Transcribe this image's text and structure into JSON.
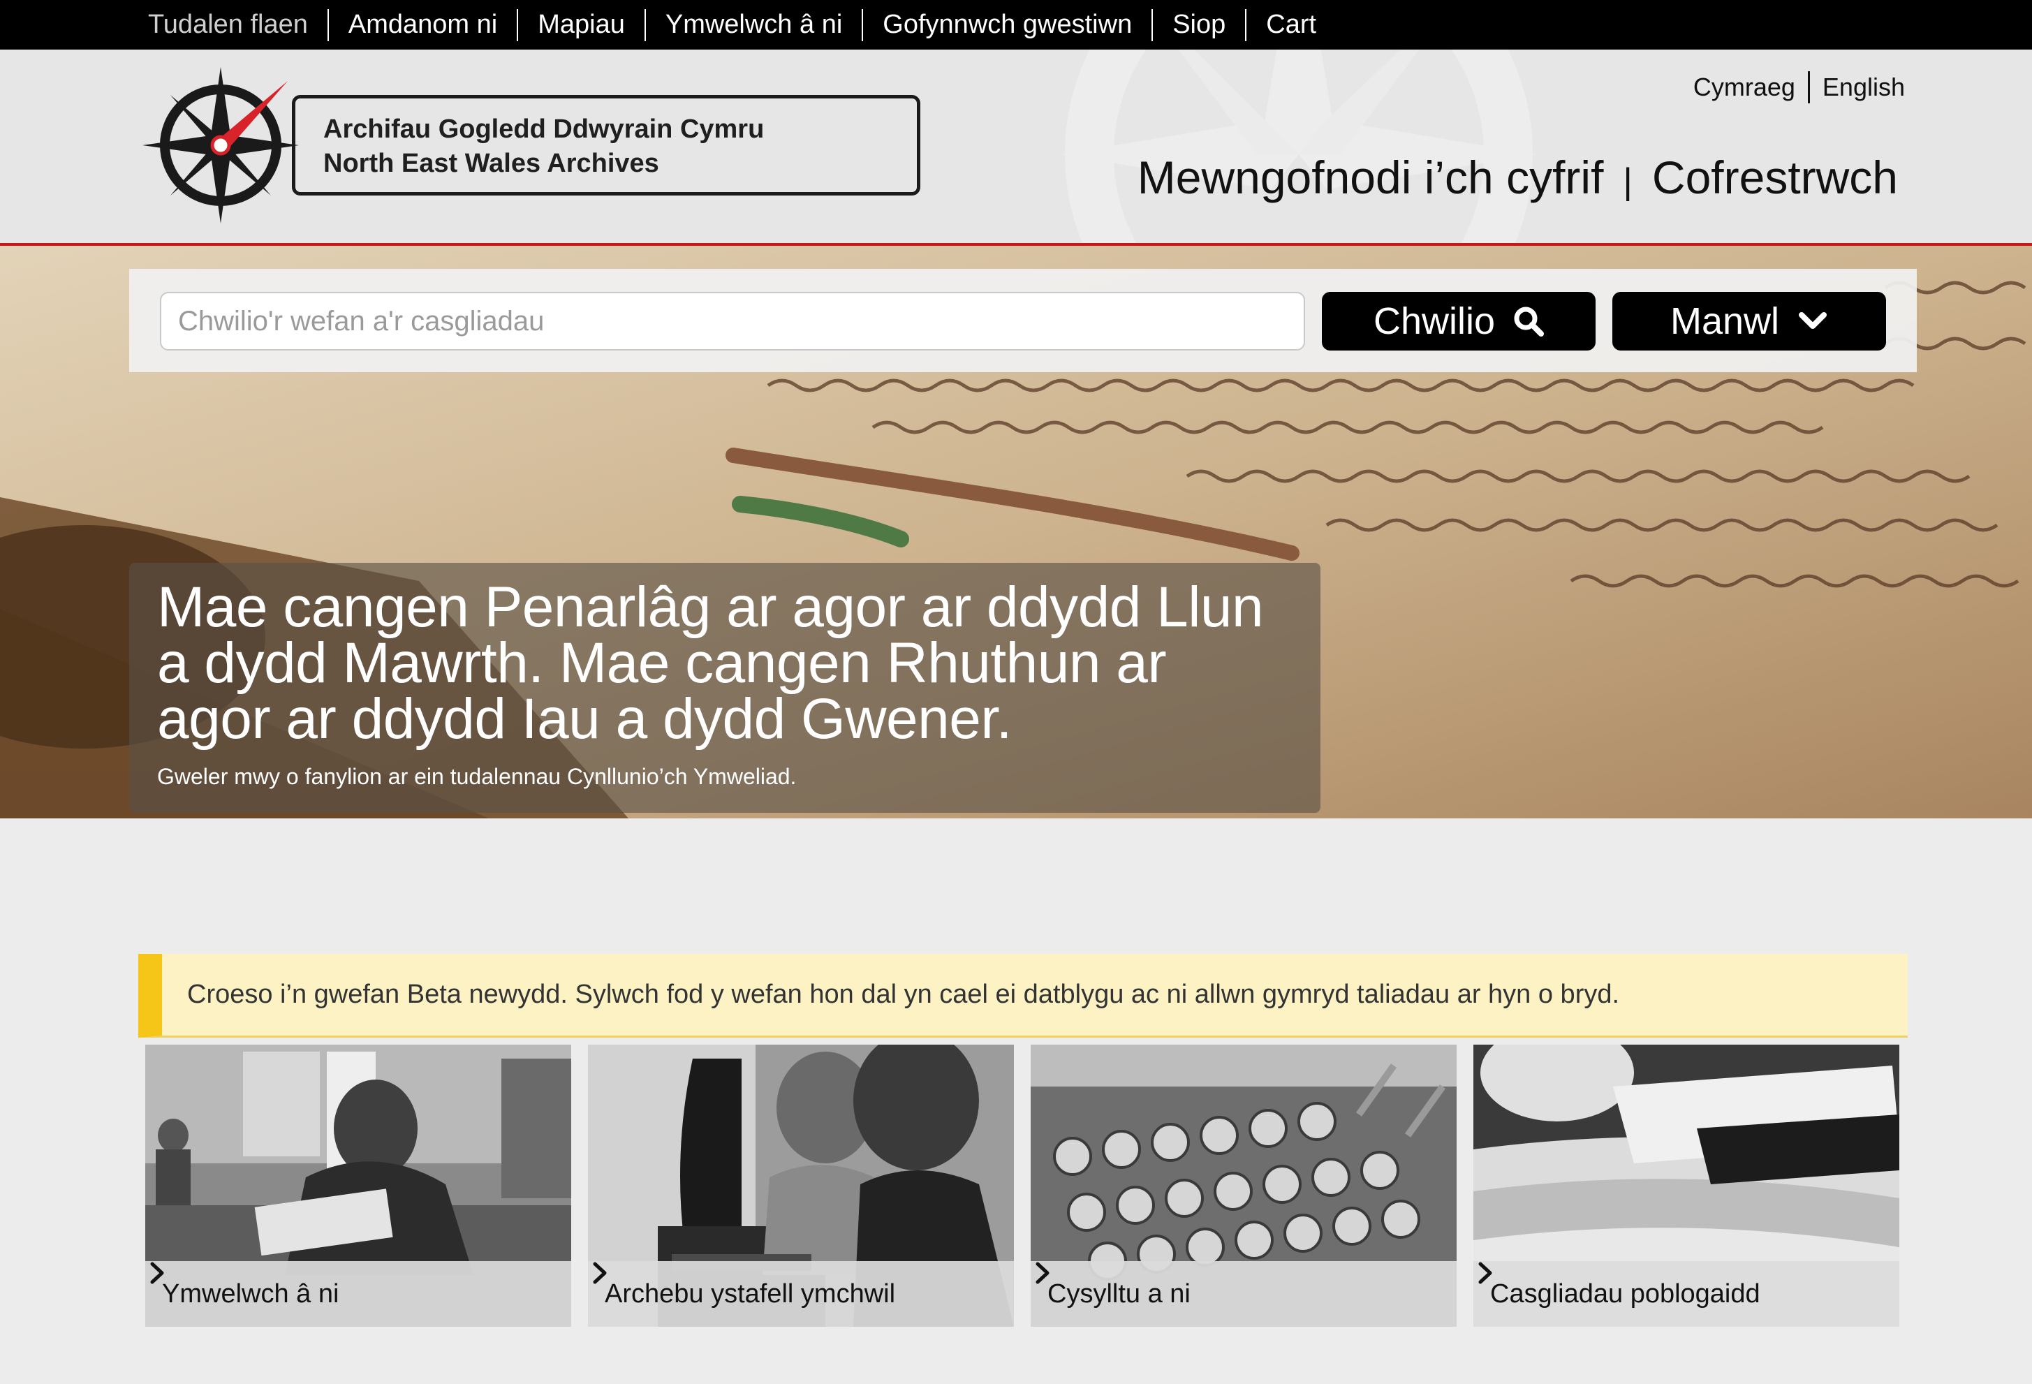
{
  "topnav": {
    "items": [
      {
        "label": "Tudalen flaen"
      },
      {
        "label": "Amdanom ni"
      },
      {
        "label": "Mapiau"
      },
      {
        "label": "Ymwelwch â ni"
      },
      {
        "label": "Gofynnwch gwestiwn"
      },
      {
        "label": "Siop"
      },
      {
        "label": "Cart"
      }
    ]
  },
  "header": {
    "logo_line1": "Archifau Gogledd Ddwyrain Cymru",
    "logo_line2": "North East Wales Archives",
    "lang_cy": "Cymraeg",
    "lang_en": "English",
    "login": "Mewngofnodi i’ch cyfrif",
    "separator": "|",
    "register": "Cofrestrwch"
  },
  "search": {
    "placeholder": "Chwilio'r wefan a'r casgliadau",
    "search_label": "Chwilio",
    "advanced_label": "Manwl"
  },
  "hero": {
    "headline": "Mae cangen Penarlâg ar agor ar ddydd Llun a dydd Mawrth. Mae cangen Rhuthun ar agor ar ddydd Iau a dydd Gwener.",
    "subtext": "Gweler mwy o fanylion ar ein tudalennau Cynllunio’ch Ymweliad."
  },
  "beta_notice": "Croeso i’n gwefan Beta newydd. Sylwch fod y wefan hon dal yn cael ei datblygu ac ni allwn gymryd taliadau ar hyn o bryd.",
  "cards": [
    {
      "label": "Ymwelwch â ni"
    },
    {
      "label": "Archebu ystafell ymchwil"
    },
    {
      "label": "Cysylltu a ni"
    },
    {
      "label": "Casgliadau poblogaidd"
    }
  ],
  "colors": {
    "accent_red": "#c8161d",
    "beta_yellow": "#f5c518",
    "nav_black": "#000000"
  },
  "icons": [
    "compass-logo-icon",
    "search-icon",
    "chevron-down-icon",
    "chevron-right-icon"
  ]
}
